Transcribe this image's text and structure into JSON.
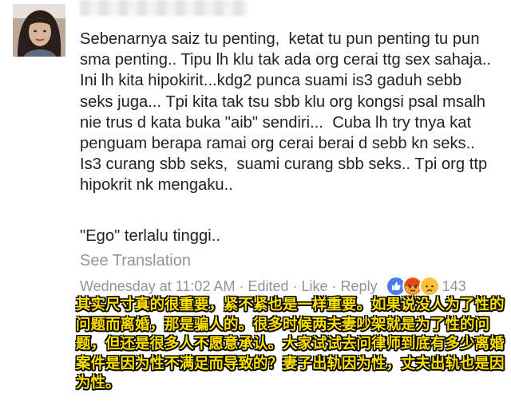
{
  "comment": {
    "text": "Sebenarnya saiz tu penting,  ketat tu pun penting tu pun sma penting.. Tipu lh klu tak ada org cerai ttg sex sahaja.. Ini lh kita hipokirit...kdg2 punca suami is3 gaduh sebb seks juga... Tpi kita tak tsu sbb klu org kongsi psal msalh nie trus d kata buka \"aib\" sendiri...  Cuba lh try tnya kat penguam berapa ramai org cerai berai d sebb kn seks.. Is3 curang sbb seks,  suami curang sbb seks.. Tpi org ttp hipokrit nk mengaku..",
    "ego_line": "\"Ego\" terlalu tinggi..",
    "see_translation": "See Translation"
  },
  "meta": {
    "timestamp": "Wednesday at 11:02 AM",
    "edited": "Edited",
    "like": "Like",
    "reply": "Reply",
    "separator": "·",
    "reaction_count": "143",
    "reactions": [
      "like-reaction-icon",
      "angry-reaction-icon",
      "sad-reaction-icon"
    ]
  },
  "translation": {
    "text": "其实尺寸真的很重要，紧不紧也是一样重要。如果说没人为了性的问题而离婚，那是骗人的。很多时候两夫妻吵架就是为了性的问题，但还是很多人不愿意承认。大家试试去问律师到底有多少离婚案件是因为性不满足而导致的？妻子出轨因为性，丈夫出轨也是因为性。"
  },
  "colors": {
    "text": "#1d2129",
    "muted": "#90949c",
    "link": "#4267b2",
    "translation_fill": "#ffe100"
  }
}
